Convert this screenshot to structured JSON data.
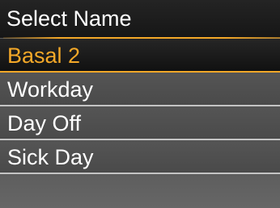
{
  "header": {
    "title": "Select Name"
  },
  "list": {
    "items": [
      {
        "label": "Basal 2",
        "selected": true
      },
      {
        "label": "Workday",
        "selected": false
      },
      {
        "label": "Day Off",
        "selected": false
      },
      {
        "label": "Sick Day",
        "selected": false
      }
    ]
  },
  "colors": {
    "accent": "#f4a828",
    "header_bg": "#1b1b1b",
    "row_bg": "#505050",
    "divider": "#c4c4c4",
    "text": "#ffffff"
  }
}
